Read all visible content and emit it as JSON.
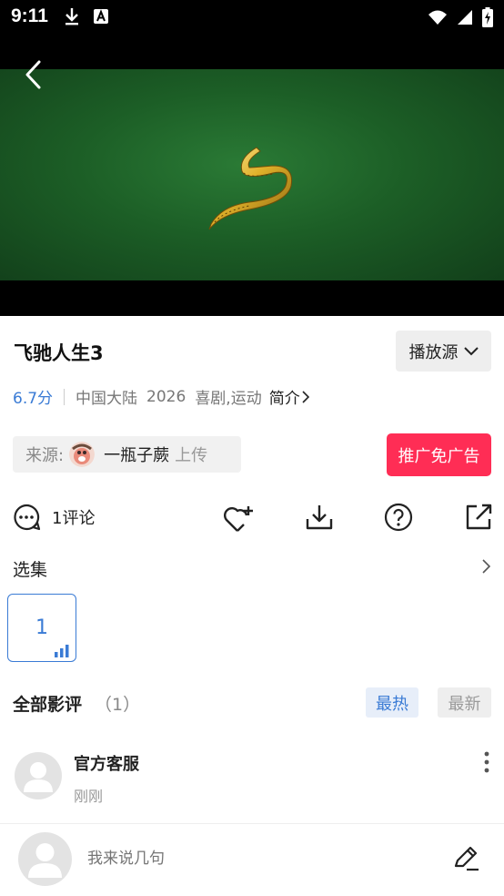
{
  "status_bar": {
    "time": "9:11",
    "left_icons": [
      "download-icon",
      "a-icon"
    ],
    "right_icons": [
      "wifi-icon",
      "signal-icon",
      "battery-charging-icon"
    ]
  },
  "video": {
    "back_icon": "chevron-left-icon",
    "frame_color": "#1c5e26"
  },
  "movie": {
    "title": "飞驰人生3",
    "source_button_label": "播放源",
    "rating": "6.7分",
    "region": "中国大陆",
    "year": "2026",
    "genres": "喜剧,运动",
    "intro_label": "简介"
  },
  "uploader": {
    "prefix": "来源:",
    "name": "一瓶子蕨",
    "action": "上传"
  },
  "ad_button_label": "推广免广告",
  "actions": {
    "comment_label": "1评论",
    "icons": [
      "comment-icon",
      "favorite-add-icon",
      "download-icon",
      "help-icon",
      "share-icon"
    ]
  },
  "episodes": {
    "title": "选集",
    "items": [
      {
        "label": "1",
        "playing": true
      }
    ]
  },
  "reviews": {
    "title": "全部影评",
    "count": "（1）",
    "sort_hot": "最热",
    "sort_new": "最新",
    "items": [
      {
        "author": "官方客服",
        "time": "刚刚"
      }
    ]
  },
  "bottom_bar": {
    "placeholder": "我来说几句"
  },
  "colors": {
    "accent_blue": "#3a7bd5",
    "ad_red": "#ff2d55"
  }
}
